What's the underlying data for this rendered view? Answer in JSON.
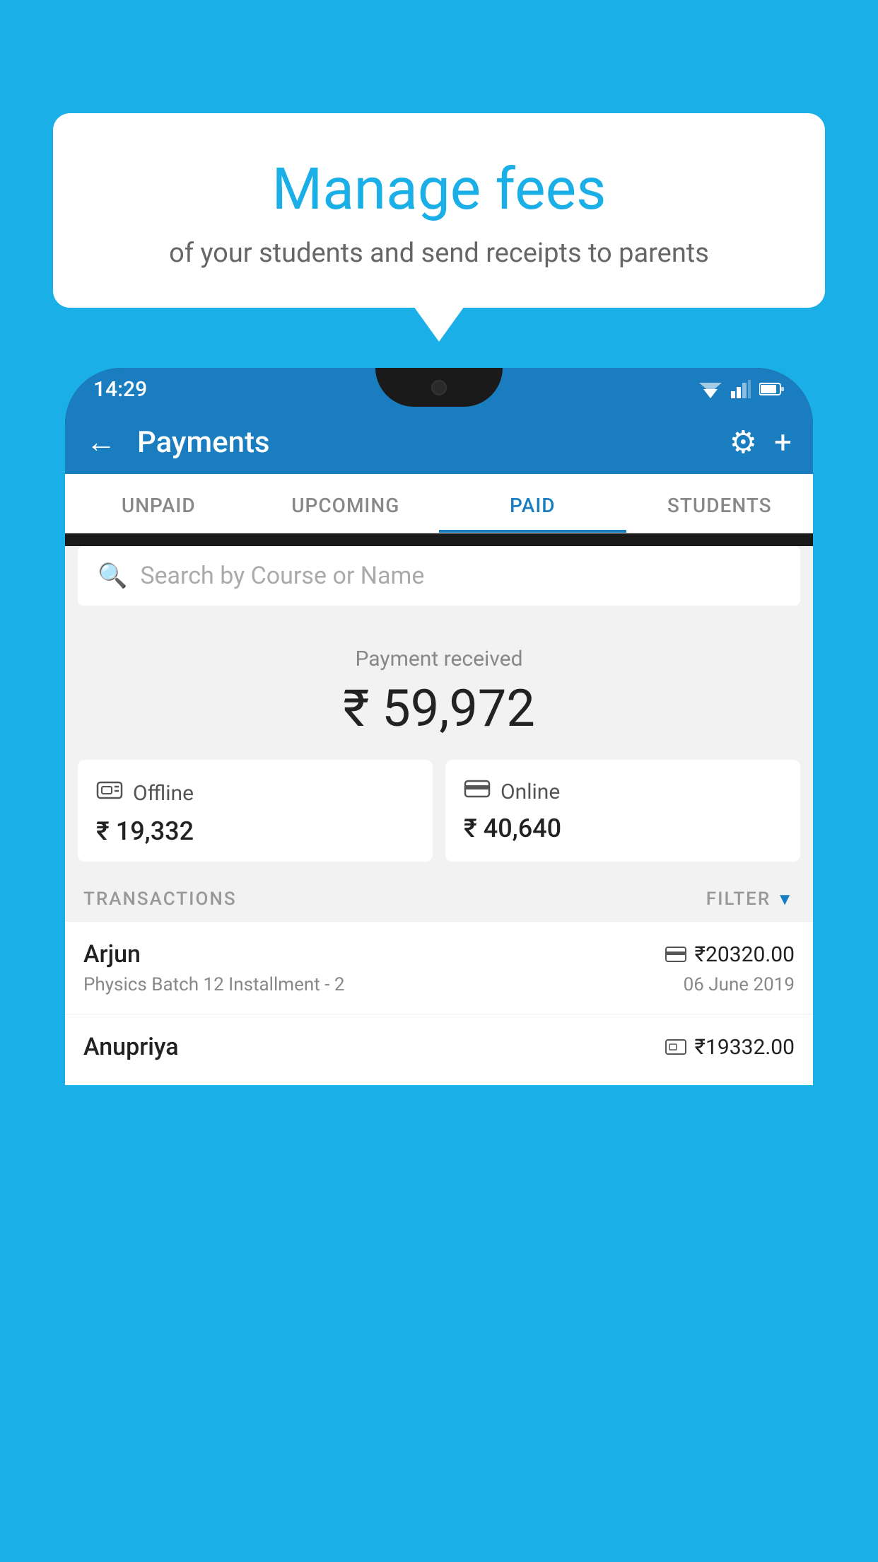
{
  "background_color": "#1AAFE6",
  "speech_bubble": {
    "title": "Manage fees",
    "subtitle": "of your students and send receipts to parents"
  },
  "status_bar": {
    "time": "14:29"
  },
  "app_header": {
    "title": "Payments",
    "back_label": "←",
    "settings_label": "⚙",
    "add_label": "+"
  },
  "tabs": [
    {
      "label": "UNPAID",
      "active": false
    },
    {
      "label": "UPCOMING",
      "active": false
    },
    {
      "label": "PAID",
      "active": true
    },
    {
      "label": "STUDENTS",
      "active": false
    }
  ],
  "search": {
    "placeholder": "Search by Course or Name"
  },
  "payment": {
    "received_label": "Payment received",
    "amount": "₹ 59,972",
    "offline_label": "Offline",
    "offline_amount": "₹ 19,332",
    "online_label": "Online",
    "online_amount": "₹ 40,640"
  },
  "transactions": {
    "section_label": "TRANSACTIONS",
    "filter_label": "FILTER",
    "items": [
      {
        "name": "Arjun",
        "course": "Physics Batch 12 Installment - 2",
        "amount": "₹20320.00",
        "date": "06 June 2019",
        "payment_type": "online"
      },
      {
        "name": "Anupriya",
        "course": "",
        "amount": "₹19332.00",
        "date": "",
        "payment_type": "offline"
      }
    ]
  }
}
